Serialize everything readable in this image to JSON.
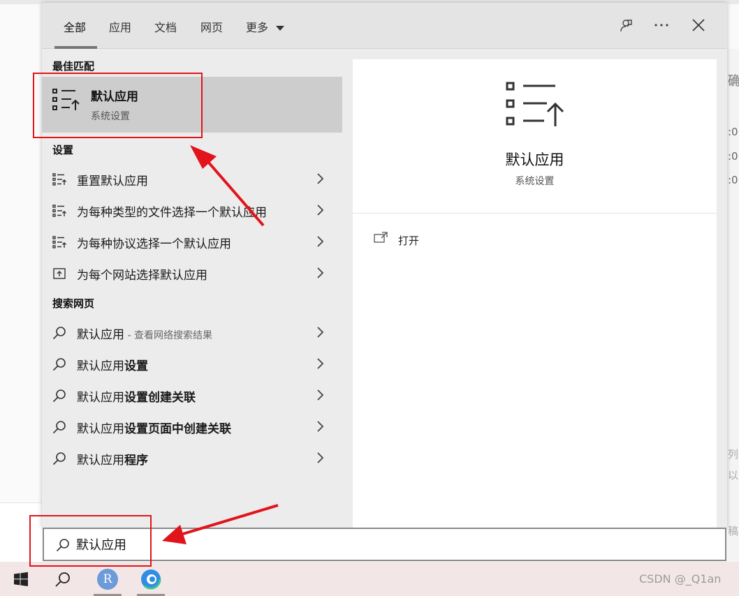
{
  "tabs": {
    "all": "全部",
    "apps": "应用",
    "docs": "文档",
    "web": "网页",
    "more": "更多"
  },
  "toolbar_icons": [
    "feedback-icon",
    "more-options-icon",
    "close-icon"
  ],
  "best_match": {
    "section_title": "最佳匹配",
    "title": "默认应用",
    "subtitle": "系统设置"
  },
  "settings": {
    "section_title": "设置",
    "items": [
      {
        "label": "重置默认应用",
        "icon": "default-apps-icon"
      },
      {
        "label": "为每种类型的文件选择一个默认应用",
        "icon": "default-apps-icon"
      },
      {
        "label": "为每种协议选择一个默认应用",
        "icon": "default-apps-icon"
      },
      {
        "label": "为每个网站选择默认应用",
        "icon": "website-icon"
      }
    ]
  },
  "web": {
    "section_title": "搜索网页",
    "items": [
      {
        "prefix": "默认应用",
        "bold": "",
        "hint": " - 查看网络搜索结果"
      },
      {
        "prefix": "默认应用",
        "bold": "设置",
        "hint": ""
      },
      {
        "prefix": "默认应用",
        "bold": "设置创建关联",
        "hint": ""
      },
      {
        "prefix": "默认应用",
        "bold": "设置页面中创建关联",
        "hint": ""
      },
      {
        "prefix": "默认应用",
        "bold": "程序",
        "hint": ""
      }
    ]
  },
  "preview": {
    "title": "默认应用",
    "subtitle": "系统设置",
    "open_label": "打开"
  },
  "search": {
    "value": "默认应用"
  },
  "taskbar": {
    "avatar_letter": "R"
  },
  "background": {
    "edge_texts": [
      "确",
      ":0",
      ":0",
      ":0",
      "列",
      "以",
      "稿"
    ]
  },
  "watermark": "CSDN @_Q1an",
  "colors": {
    "annotation": "#e1141b",
    "best_match_bg": "#cdcdcd",
    "panel_bg": "#ececec"
  }
}
